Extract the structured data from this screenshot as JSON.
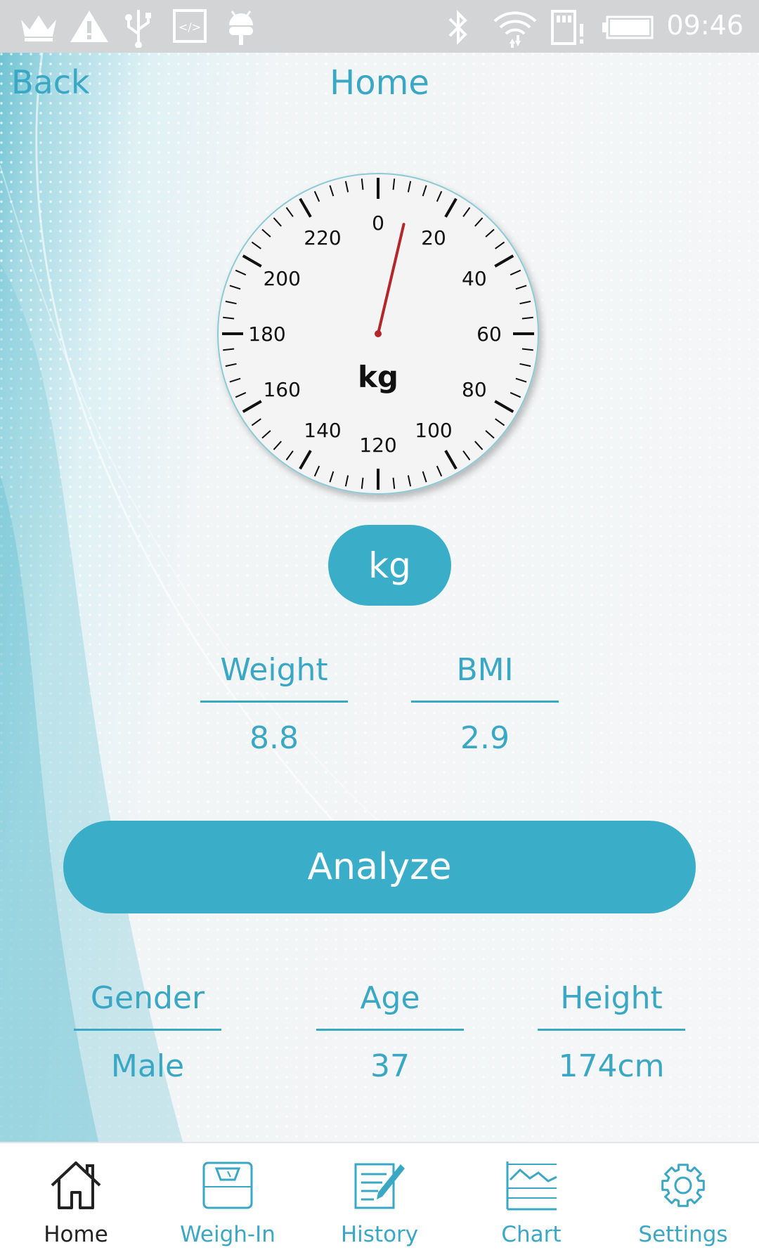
{
  "status_bar": {
    "time": "09:46",
    "left_icons": [
      "crown-icon",
      "warning-icon",
      "usb-icon",
      "code-icon",
      "android-icon"
    ],
    "right_icons": [
      "bluetooth-icon",
      "wifi-icon",
      "sd-card-alert-icon",
      "battery-icon"
    ]
  },
  "header": {
    "back_label": "Back",
    "title": "Home"
  },
  "gauge": {
    "unit_label": "kg",
    "scale_labels": [
      "0",
      "20",
      "40",
      "60",
      "80",
      "100",
      "120",
      "140",
      "160",
      "180",
      "200",
      "220"
    ],
    "max": 240,
    "needle_value": 8.8,
    "needle_color": "#b3262a"
  },
  "unit_toggle": {
    "label": "kg"
  },
  "stats": {
    "weight": {
      "label": "Weight",
      "value": "8.8"
    },
    "bmi": {
      "label": "BMI",
      "value": "2.9"
    }
  },
  "analyze_label": "Analyze",
  "profile": {
    "gender": {
      "label": "Gender",
      "value": "Male"
    },
    "age": {
      "label": "Age",
      "value": "37"
    },
    "height": {
      "label": "Height",
      "value": "174cm"
    }
  },
  "nav": {
    "items": [
      {
        "label": "Home",
        "icon": "home-icon",
        "active": true
      },
      {
        "label": "Weigh-In",
        "icon": "scale-icon",
        "active": false
      },
      {
        "label": "History",
        "icon": "history-icon",
        "active": false
      },
      {
        "label": "Chart",
        "icon": "chart-icon",
        "active": false
      },
      {
        "label": "Settings",
        "icon": "settings-icon",
        "active": false
      }
    ]
  },
  "colors": {
    "accent": "#3aaec8",
    "text_accent": "#3aa7c4",
    "status_bar": "#d2d4d5"
  }
}
